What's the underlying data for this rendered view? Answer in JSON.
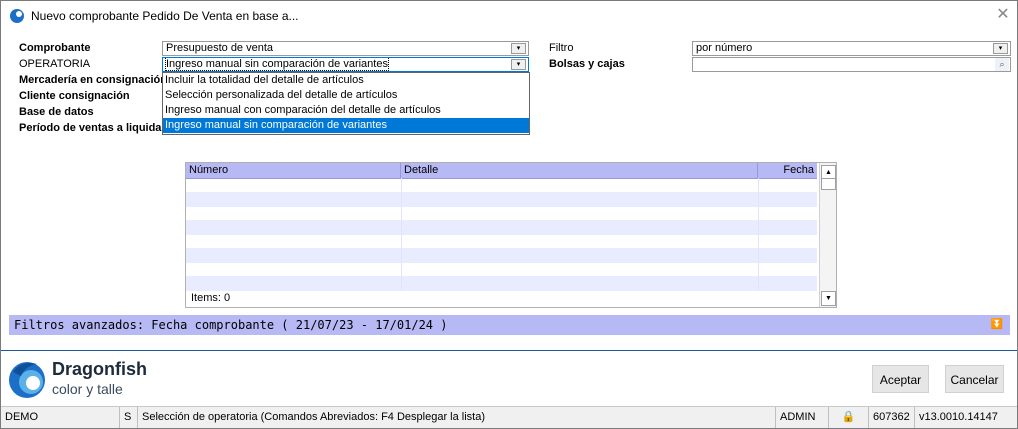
{
  "window": {
    "title": "Nuevo comprobante Pedido De Venta en base a...",
    "close_glyph": "✕"
  },
  "form": {
    "comprobante_label": "Comprobante",
    "comprobante_value": "Presupuesto de venta",
    "operatoria_label": "OPERATORIA",
    "operatoria_value": "Ingreso manual sin comparación de variantes",
    "mercaderia_label": "Mercadería en consignación",
    "cliente_label": "Cliente consignación",
    "base_label": "Base de datos",
    "periodo_label": "Período de ventas a liquidar",
    "filtro_label": "Filtro",
    "filtro_value": "por número",
    "bolsas_label": "Bolsas y cajas",
    "bolsas_value": "",
    "lookup_icon": "magnifier-icon"
  },
  "dropdown": {
    "options": [
      "Incluir la totalidad del detalle de artículos",
      "Selección personalizada del detalle de artículos",
      "Ingreso manual con comparación del detalle de artículos",
      "Ingreso manual sin comparación de variantes"
    ],
    "selected_index": 3
  },
  "grid": {
    "columns": [
      "Número",
      "Detalle",
      "Fecha"
    ],
    "rows": [],
    "items_label": "Items: 0"
  },
  "filters": {
    "text": "Filtros avanzados: Fecha comprobante ( 21/07/23 - 17/01/24 )",
    "expand_glyph": "⏬"
  },
  "brand": {
    "name": "Dragonfish",
    "tagline": "color y talle"
  },
  "buttons": {
    "accept": "Aceptar",
    "cancel": "Cancelar"
  },
  "statusbar": {
    "db": "DEMO",
    "mode": "S",
    "message": "Selección de operatoria (Comandos Abreviados: F4 Desplegar la lista)",
    "user": "ADMIN",
    "lock_icon": "lock-icon",
    "code": "607362",
    "version": "v13.0010.14147"
  },
  "colors": {
    "accent": "#0078d7",
    "grid_header": "#b7b9f5",
    "filter_bar": "#b7b9f5",
    "brand_blue": "#1c6fc7"
  }
}
